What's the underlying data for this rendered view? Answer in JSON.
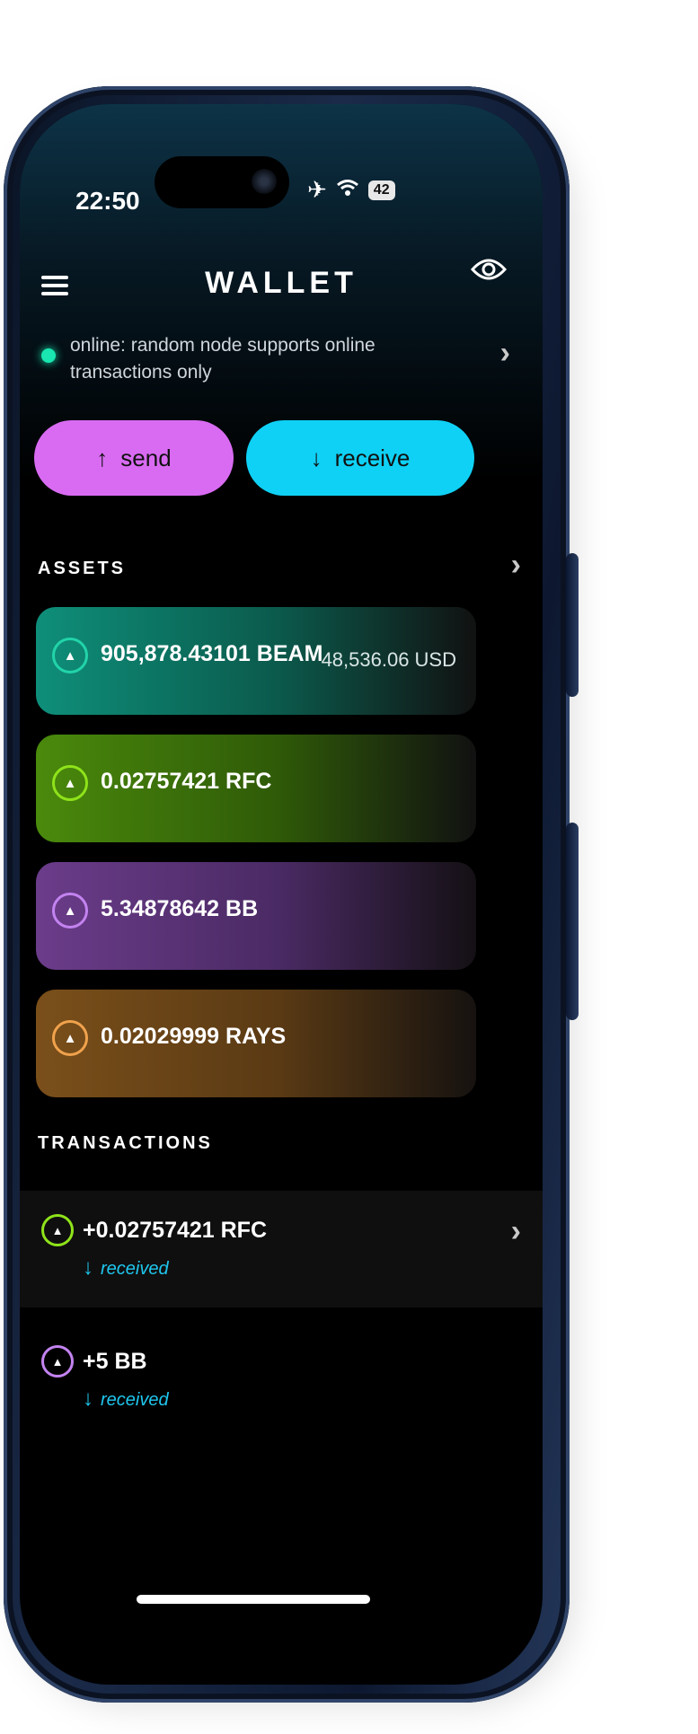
{
  "status_bar": {
    "time": "22:50",
    "battery": "42"
  },
  "header": {
    "title": "WALLET"
  },
  "connection": {
    "status": "online: random node supports online transactions only"
  },
  "actions": {
    "send": "send",
    "receive": "receive"
  },
  "assets": {
    "label": "ASSETS",
    "items": [
      {
        "amount": "905,878.43101 BEAM",
        "usd": "48,536.06 USD",
        "color": "#22d4a9"
      },
      {
        "amount": "0.02757421 RFC",
        "color": "#8fe31a"
      },
      {
        "amount": "5.34878642 BB",
        "color": "#c383f0"
      },
      {
        "amount": "0.02029999 RAYS",
        "color": "#f0a24c"
      }
    ]
  },
  "transactions": {
    "label": "TRANSACTIONS",
    "items": [
      {
        "amount": "+0.02757421 RFC",
        "status": "received",
        "color": "#8fe31a"
      },
      {
        "amount": "+5 BB",
        "status": "received",
        "color": "#c383f0"
      }
    ]
  }
}
